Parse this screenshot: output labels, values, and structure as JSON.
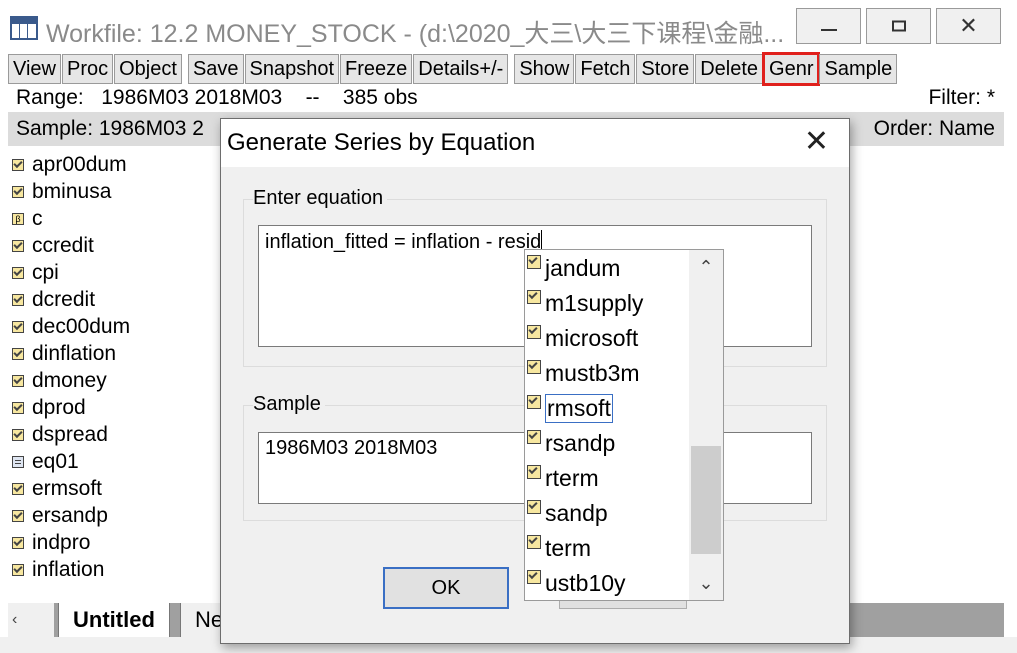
{
  "window": {
    "title": "Workfile: 12.2 MONEY_STOCK - (d:\\2020_大三\\大三下课程\\金融...",
    "icons": {
      "minimize": "minimize-icon",
      "maximize": "maximize-icon",
      "close": "close-icon"
    },
    "close_glyph": "✕"
  },
  "toolbar": {
    "buttons": [
      "View",
      "Proc",
      "Object",
      "Save",
      "Snapshot",
      "Freeze",
      "Details+/-",
      "Show",
      "Fetch",
      "Store",
      "Delete",
      "Genr",
      "Sample"
    ],
    "highlight_color": "#e0201c"
  },
  "info": {
    "range_label": "Range:",
    "range_value": "1986M03 2018M03",
    "range_sep": "--",
    "obs": "385 obs",
    "filter": "Filter: *",
    "sample_prefix": "Sample: 1986M03 2",
    "order": "Order: Name"
  },
  "objects": [
    {
      "name": "apr00dum",
      "icon": "series-icon"
    },
    {
      "name": "bminusa",
      "icon": "series-icon"
    },
    {
      "name": "c",
      "icon": "coefficient-icon"
    },
    {
      "name": "ccredit",
      "icon": "series-icon"
    },
    {
      "name": "cpi",
      "icon": "series-icon"
    },
    {
      "name": "dcredit",
      "icon": "series-icon"
    },
    {
      "name": "dec00dum",
      "icon": "series-icon"
    },
    {
      "name": "dinflation",
      "icon": "series-icon"
    },
    {
      "name": "dmoney",
      "icon": "series-icon"
    },
    {
      "name": "dprod",
      "icon": "series-icon"
    },
    {
      "name": "dspread",
      "icon": "series-icon"
    },
    {
      "name": "eq01",
      "icon": "equation-icon"
    },
    {
      "name": "ermsoft",
      "icon": "series-icon"
    },
    {
      "name": "ersandp",
      "icon": "series-icon"
    },
    {
      "name": "indpro",
      "icon": "series-icon"
    },
    {
      "name": "inflation",
      "icon": "series-icon"
    }
  ],
  "coef_glyph": "β",
  "tabs": {
    "nav": "‹ ›",
    "active": "Untitled",
    "next": "New Page"
  },
  "dialog": {
    "title": "Generate Series by Equation",
    "close_glyph": "✕",
    "equation_label": "Enter equation",
    "equation_value": "inflation_fitted = inflation - resid",
    "sample_label": "Sample",
    "sample_value": "1986M03 2018M03",
    "ok": "OK"
  },
  "autocomplete": {
    "items": [
      "jandum",
      "m1supply",
      "microsoft",
      "mustb3m",
      "rmsoft",
      "rsandp",
      "rterm",
      "sandp",
      "term",
      "ustb10y"
    ],
    "selected": "rmsoft",
    "scroll_up": "⌃",
    "scroll_down": "⌄"
  }
}
